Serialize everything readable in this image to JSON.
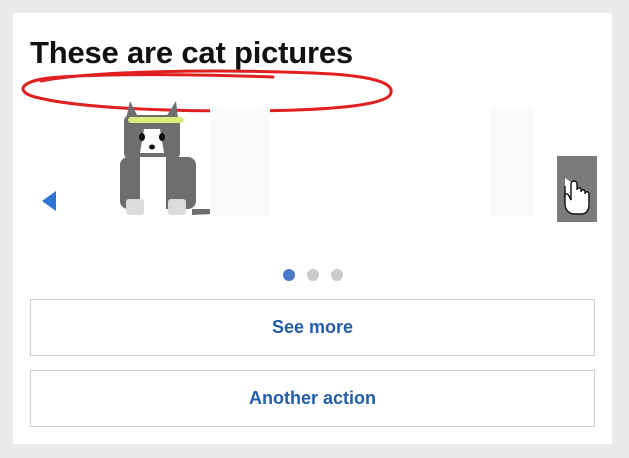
{
  "card": {
    "title": "These are cat pictures"
  },
  "carousel": {
    "slides": [
      {
        "image_alt": "cat",
        "active": true
      },
      {
        "active": false
      },
      {
        "active": false
      }
    ],
    "active_index": 0,
    "prev_icon": "triangle-left-icon",
    "next_icon": "triangle-right-icon"
  },
  "actions": {
    "see_more": "See more",
    "another_action": "Another action"
  },
  "colors": {
    "accent_blue": "#215da8",
    "prev_arrow": "#2f73d2",
    "annotation_red": "#e02020",
    "cat_gray": "#6e6e6e",
    "headband": "#d8ec7a"
  }
}
